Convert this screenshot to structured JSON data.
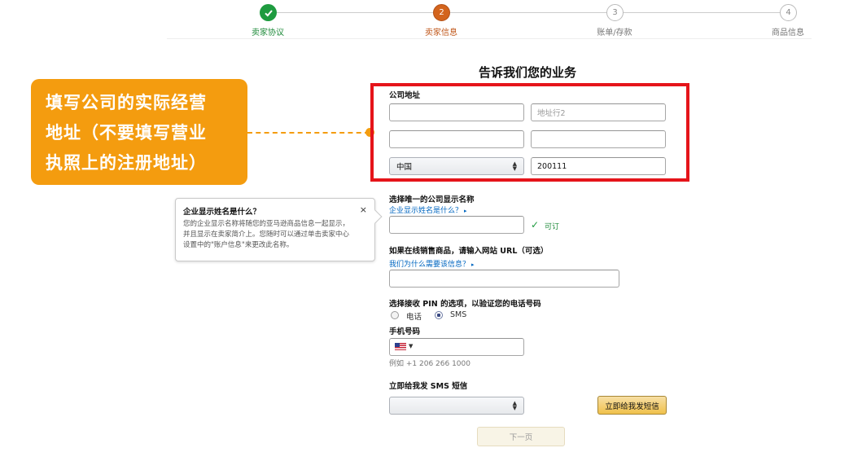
{
  "stepper": {
    "steps": [
      {
        "label": "卖家协议",
        "number": "",
        "state": "done"
      },
      {
        "label": "卖家信息",
        "number": "2",
        "state": "current"
      },
      {
        "label": "账单/存款",
        "number": "3",
        "state": "pending"
      },
      {
        "label": "商品信息",
        "number": "4",
        "state": "pending"
      }
    ]
  },
  "page_title": "告诉我们您的业务",
  "annotation": {
    "lines": [
      "填写公司的实际经营",
      "地址（不要填写营业",
      "执照上的注册地址）"
    ]
  },
  "address": {
    "label": "公司地址",
    "line1_value": "",
    "line2_placeholder": "地址行2",
    "city_value": "",
    "state_value": "",
    "country_value": "中国",
    "postcode_value": "200111"
  },
  "display_name": {
    "label": "选择唯一的公司显示名称",
    "help_link": "企业显示姓名是什么？",
    "value": "",
    "status": "可订"
  },
  "tooltip": {
    "title": "企业显示姓名是什么？",
    "body_lines": [
      "您的企业显示名称将随您的亚马逊商品信息一起显示，",
      "并且显示在卖家简介上。您随时可以通过单击卖家中心",
      "设置中的\"账户信息\"来更改此名称。"
    ],
    "close": "×"
  },
  "website": {
    "label": "如果在线销售商品，请输入网站 URL（可选）",
    "help_link": "我们为什么需要该信息？",
    "value": ""
  },
  "pin": {
    "label": "选择接收 PIN 的选项，以验证您的电话号码",
    "option_phone": "电话",
    "option_sms": "SMS",
    "selected": "SMS"
  },
  "mobile": {
    "label": "手机号码",
    "country_flag": "us-flag-icon",
    "value": "",
    "example": "例如 +1 206 266 1000"
  },
  "sms": {
    "label": "立即给我发 SMS 短信",
    "language_value": "",
    "send_button": "立即给我发短信"
  },
  "next_button": "下一页",
  "colors": {
    "done": "#1e9b3f",
    "current": "#d3641d",
    "callout": "#f49c0f",
    "highlight": "#e5141a",
    "link": "#0066c0"
  }
}
